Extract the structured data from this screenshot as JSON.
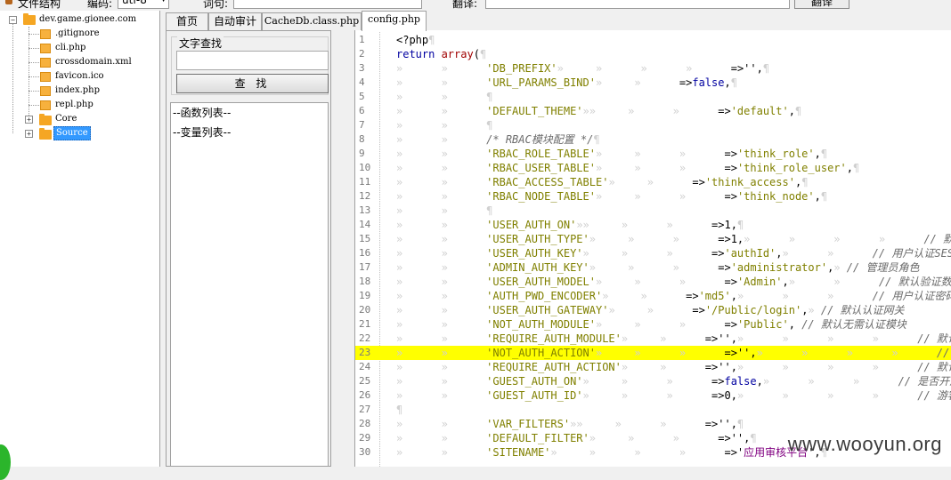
{
  "topbar": {
    "file_structure_label": "文件结构",
    "encoding_label": "编码:",
    "encoding_value": "utf-8",
    "query_label": "词句:",
    "translate_label": "翻译:",
    "translate_button": "翻译"
  },
  "tree": {
    "root": "dev.game.gionee.com",
    "items": [
      ".gitignore",
      "cli.php",
      "crossdomain.xml",
      "favicon.ico",
      "index.php",
      "repl.php"
    ],
    "folders": [
      "Core",
      "Source"
    ]
  },
  "tabs": [
    "首页",
    "自动审计",
    "CacheDb.class.php",
    "config.php"
  ],
  "search": {
    "title": "文字查找",
    "input_value": "",
    "button": "查 找"
  },
  "lists": {
    "functions": "--函数列表--",
    "variables": "--变量列表--"
  },
  "code": {
    "highlight_line": 23,
    "lines": [
      {
        "n": "1",
        "parts": [
          [
            "op",
            "<?php"
          ],
          [
            "ws",
            "¶"
          ]
        ]
      },
      {
        "n": "2",
        "parts": [
          [
            "kw",
            "return "
          ],
          [
            "fn",
            "array"
          ],
          [
            "op",
            "("
          ],
          [
            "ws",
            "¶"
          ]
        ]
      },
      {
        "n": "3",
        "parts": [
          [
            "ws",
            "»      »      "
          ],
          [
            "str",
            "'DB_PREFIX'"
          ],
          [
            "ws",
            "»     »      »      »      "
          ],
          [
            "op",
            "=>'',"
          ],
          [
            "ws",
            "¶"
          ]
        ]
      },
      {
        "n": "4",
        "parts": [
          [
            "ws",
            "»      »      "
          ],
          [
            "str",
            "'URL_PARAMS_BIND'"
          ],
          [
            "ws",
            "»     »      "
          ],
          [
            "op",
            "=>"
          ],
          [
            "kw",
            "false"
          ],
          [
            "op",
            ","
          ],
          [
            "ws",
            "¶"
          ]
        ]
      },
      {
        "n": "5",
        "parts": [
          [
            "ws",
            "»      »      ¶"
          ]
        ]
      },
      {
        "n": "6",
        "parts": [
          [
            "ws",
            "»      »      "
          ],
          [
            "str",
            "'DEFAULT_THEME'"
          ],
          [
            "ws",
            "»»     »      »      "
          ],
          [
            "op",
            "=>"
          ],
          [
            "str",
            "'default'"
          ],
          [
            "op",
            ","
          ],
          [
            "ws",
            "¶"
          ]
        ]
      },
      {
        "n": "7",
        "parts": [
          [
            "ws",
            "»      »      ¶"
          ]
        ]
      },
      {
        "n": "8",
        "parts": [
          [
            "ws",
            "»      »      "
          ],
          [
            "cmt",
            "/* RBAC模块配置 */"
          ],
          [
            "ws",
            "¶"
          ]
        ]
      },
      {
        "n": "9",
        "parts": [
          [
            "ws",
            "»      »      "
          ],
          [
            "str",
            "'RBAC_ROLE_TABLE'"
          ],
          [
            "ws",
            "»     »      »      "
          ],
          [
            "op",
            "=>"
          ],
          [
            "str",
            "'think_role'"
          ],
          [
            "op",
            ","
          ],
          [
            "ws",
            "¶"
          ]
        ]
      },
      {
        "n": "10",
        "parts": [
          [
            "ws",
            "»      »      "
          ],
          [
            "str",
            "'RBAC_USER_TABLE'"
          ],
          [
            "ws",
            "»     »      »      "
          ],
          [
            "op",
            "=>"
          ],
          [
            "str",
            "'think_role_user'"
          ],
          [
            "op",
            ","
          ],
          [
            "ws",
            "¶"
          ]
        ]
      },
      {
        "n": "11",
        "parts": [
          [
            "ws",
            "»      »      "
          ],
          [
            "str",
            "'RBAC_ACCESS_TABLE'"
          ],
          [
            "ws",
            "»     »      "
          ],
          [
            "op",
            "=>"
          ],
          [
            "str",
            "'think_access'"
          ],
          [
            "op",
            ","
          ],
          [
            "ws",
            "¶"
          ]
        ]
      },
      {
        "n": "12",
        "parts": [
          [
            "ws",
            "»      »      "
          ],
          [
            "str",
            "'RBAC_NODE_TABLE'"
          ],
          [
            "ws",
            "»     »      »      "
          ],
          [
            "op",
            "=>"
          ],
          [
            "str",
            "'think_node'"
          ],
          [
            "op",
            ","
          ],
          [
            "ws",
            "¶"
          ]
        ]
      },
      {
        "n": "13",
        "parts": [
          [
            "ws",
            "»      »      ¶"
          ]
        ]
      },
      {
        "n": "14",
        "parts": [
          [
            "ws",
            "»      »      "
          ],
          [
            "str",
            "'USER_AUTH_ON'"
          ],
          [
            "ws",
            "»»     »      »      "
          ],
          [
            "op",
            "=>1,"
          ],
          [
            "ws",
            "¶"
          ]
        ]
      },
      {
        "n": "15",
        "parts": [
          [
            "ws",
            "»      »      "
          ],
          [
            "str",
            "'USER_AUTH_TYPE'"
          ],
          [
            "ws",
            "»     »      »      "
          ],
          [
            "op",
            "=>1,"
          ],
          [
            "ws",
            "»      »      »      »      "
          ],
          [
            "cmt",
            "// 默认认证类型"
          ]
        ]
      },
      {
        "n": "16",
        "parts": [
          [
            "ws",
            "»      »      "
          ],
          [
            "str",
            "'USER_AUTH_KEY'"
          ],
          [
            "ws",
            "»     »      »      "
          ],
          [
            "op",
            "=>"
          ],
          [
            "str",
            "'authId'"
          ],
          [
            "op",
            ","
          ],
          [
            "ws",
            "»      »      "
          ],
          [
            "cmt",
            "// 用户认证SESS"
          ]
        ]
      },
      {
        "n": "17",
        "parts": [
          [
            "ws",
            "»      »      "
          ],
          [
            "str",
            "'ADMIN_AUTH_KEY'"
          ],
          [
            "ws",
            "»     »      »      "
          ],
          [
            "op",
            "=>"
          ],
          [
            "str",
            "'administrator'"
          ],
          [
            "op",
            ","
          ],
          [
            "ws",
            "» "
          ],
          [
            "cmt",
            "// 管理员角色"
          ]
        ]
      },
      {
        "n": "18",
        "parts": [
          [
            "ws",
            "»      »      "
          ],
          [
            "str",
            "'USER_AUTH_MODEL'"
          ],
          [
            "ws",
            "»     »      »      "
          ],
          [
            "op",
            "=>"
          ],
          [
            "str",
            "'Admin'"
          ],
          [
            "op",
            ","
          ],
          [
            "ws",
            "»      »      "
          ],
          [
            "cmt",
            "// 默认验证数据"
          ]
        ]
      },
      {
        "n": "19",
        "parts": [
          [
            "ws",
            "»      »      "
          ],
          [
            "str",
            "'AUTH_PWD_ENCODER'"
          ],
          [
            "ws",
            "»     »      "
          ],
          [
            "op",
            "=>"
          ],
          [
            "str",
            "'md5'"
          ],
          [
            "op",
            ","
          ],
          [
            "ws",
            "»      »      »      "
          ],
          [
            "cmt",
            "// 用户认证密码"
          ]
        ]
      },
      {
        "n": "20",
        "parts": [
          [
            "ws",
            "»      »      "
          ],
          [
            "str",
            "'USER_AUTH_GATEWAY'"
          ],
          [
            "ws",
            "»     »      "
          ],
          [
            "op",
            "=>"
          ],
          [
            "str",
            "'/Public/login'"
          ],
          [
            "op",
            ","
          ],
          [
            "ws",
            "» "
          ],
          [
            "cmt",
            "// 默认认证网关"
          ]
        ]
      },
      {
        "n": "21",
        "parts": [
          [
            "ws",
            "»      »      "
          ],
          [
            "str",
            "'NOT_AUTH_MODULE'"
          ],
          [
            "ws",
            "»     »      »      "
          ],
          [
            "op",
            "=>"
          ],
          [
            "str",
            "'Public'"
          ],
          [
            "op",
            ","
          ],
          [
            "ws",
            " "
          ],
          [
            "cmt",
            "// 默认无需认证模块"
          ]
        ]
      },
      {
        "n": "22",
        "parts": [
          [
            "ws",
            "»      »      "
          ],
          [
            "str",
            "'REQUIRE_AUTH_MODULE'"
          ],
          [
            "ws",
            "»     »      "
          ],
          [
            "op",
            "=>'',"
          ],
          [
            "ws",
            "»      »      »      »      "
          ],
          [
            "cmt",
            "// 默认需要认证"
          ]
        ]
      },
      {
        "n": "23",
        "parts": [
          [
            "ws",
            "»      »      "
          ],
          [
            "str",
            "'NOT_AUTH_ACTION'"
          ],
          [
            "ws",
            "»     »      »      "
          ],
          [
            "op",
            "=>'',"
          ],
          [
            "ws",
            "»      »      »      »      "
          ],
          [
            "cmt",
            "// 默认无需认证"
          ]
        ]
      },
      {
        "n": "24",
        "parts": [
          [
            "ws",
            "»      »      "
          ],
          [
            "str",
            "'REQUIRE_AUTH_ACTION'"
          ],
          [
            "ws",
            "»     »      "
          ],
          [
            "op",
            "=>'',"
          ],
          [
            "ws",
            "»      »      »      »      "
          ],
          [
            "cmt",
            "// 默认需要认证"
          ]
        ]
      },
      {
        "n": "25",
        "parts": [
          [
            "ws",
            "»      »      "
          ],
          [
            "str",
            "'GUEST_AUTH_ON'"
          ],
          [
            "ws",
            "»     »      »      "
          ],
          [
            "op",
            "=>"
          ],
          [
            "kw",
            "false"
          ],
          [
            "op",
            ","
          ],
          [
            "ws",
            "»      »      »      "
          ],
          [
            "cmt",
            "// 是否开启游客"
          ]
        ]
      },
      {
        "n": "26",
        "parts": [
          [
            "ws",
            "»      »      "
          ],
          [
            "str",
            "'GUEST_AUTH_ID'"
          ],
          [
            "ws",
            "»     »      »      "
          ],
          [
            "op",
            "=>0,"
          ],
          [
            "ws",
            "»      »      »      »      "
          ],
          [
            "cmt",
            "// 游客的用户ID"
          ]
        ]
      },
      {
        "n": "27",
        "parts": [
          [
            "ws",
            "¶"
          ]
        ]
      },
      {
        "n": "28",
        "parts": [
          [
            "ws",
            "»      »      "
          ],
          [
            "str",
            "'VAR_FILTERS'"
          ],
          [
            "ws",
            "»»     »      »      "
          ],
          [
            "op",
            "=>'',"
          ],
          [
            "ws",
            "¶"
          ]
        ]
      },
      {
        "n": "29",
        "parts": [
          [
            "ws",
            "»      »      "
          ],
          [
            "str",
            "'DEFAULT_FILTER'"
          ],
          [
            "ws",
            "»     »      »      "
          ],
          [
            "op",
            "=>'',"
          ],
          [
            "ws",
            "¶"
          ]
        ]
      },
      {
        "n": "30",
        "parts": [
          [
            "ws",
            "»      »      "
          ],
          [
            "str",
            "'SITENAME'"
          ],
          [
            "ws",
            "»     »      »      »      "
          ],
          [
            "op",
            "=>'"
          ],
          [
            "str2",
            "应用审核平台"
          ],
          [
            "op",
            "',"
          ],
          [
            "ws",
            "¶"
          ]
        ]
      }
    ]
  },
  "watermark": "www.wooyun.org"
}
